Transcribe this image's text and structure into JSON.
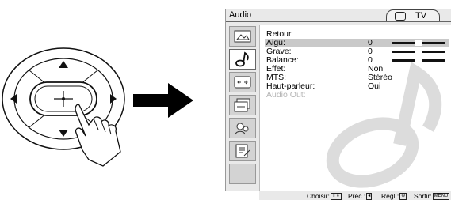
{
  "menu": {
    "title": "Audio",
    "input_mode": "TV",
    "categories": [
      {
        "icon": "picture-icon",
        "active": false
      },
      {
        "icon": "music-note-icon",
        "active": true
      },
      {
        "icon": "screen-icon",
        "active": false
      },
      {
        "icon": "channel-icon",
        "active": false
      },
      {
        "icon": "parental-lock-icon",
        "active": false
      },
      {
        "icon": "setup-icon",
        "active": false
      }
    ],
    "rows": [
      {
        "label": "Retour",
        "value": ""
      },
      {
        "label": "Aigu:",
        "value": "0",
        "bar": 0.5
      },
      {
        "label": "Grave:",
        "value": "0",
        "bar": 0.5
      },
      {
        "label": "Balance:",
        "value": "0",
        "bar": 0.5
      },
      {
        "label": "Effet:",
        "value": "Non"
      },
      {
        "label": "MTS:",
        "value": "Stéréo"
      },
      {
        "label": "Haut-parleur:",
        "value": "Oui"
      },
      {
        "label": "Audio Out:",
        "value": "",
        "disabled": true
      }
    ]
  },
  "footer": {
    "choose": "Choisir:",
    "prev": "Préc.:",
    "adjust": "Régl.:",
    "exit": "Sortir:",
    "exit_key": "MENU"
  },
  "colors": {
    "highlight": "#c9c9c9",
    "panel_bg": "#e9e9e9",
    "disabled_text": "#b5b5b5"
  }
}
